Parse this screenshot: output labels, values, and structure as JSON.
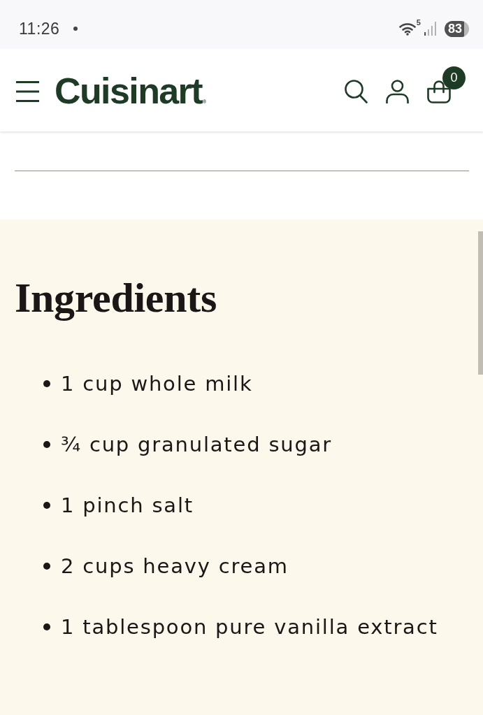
{
  "status_bar": {
    "time": "11:26",
    "wifi_badge": "5",
    "battery": "83"
  },
  "header": {
    "logo": "Cuisinart$_{®}$",
    "cart_count": "0"
  },
  "ingredients": {
    "title": "Ingredients",
    "items": [
      "1 cup whole milk",
      "¾ cup granulated sugar",
      "1 pinch salt",
      "2 cups heavy cream",
      "1 tablespoon pure vanilla extract"
    ]
  }
}
